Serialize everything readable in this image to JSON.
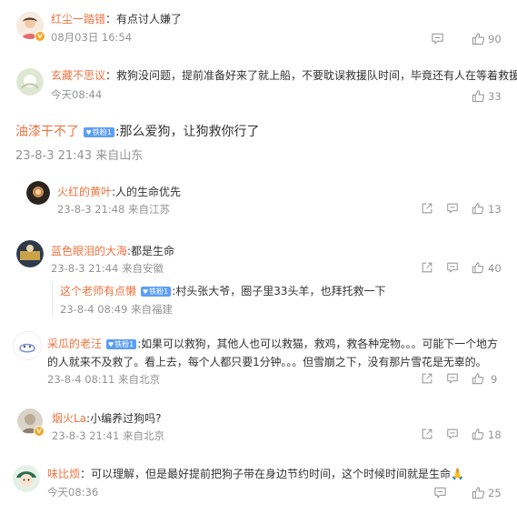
{
  "colors": {
    "name": "#eb7340",
    "meta": "#939393",
    "text": "#333333",
    "fan_badge": "#5b9ef5",
    "vip": "#f5a623"
  },
  "comments": [
    {
      "user": "红尘一踏错",
      "sep": "：",
      "text": "有点讨人嫌了",
      "time": "08月03日 16:54",
      "likes": "90"
    },
    {
      "user": "玄藏不思议",
      "sep": "：",
      "text": "救狗没问题，提前准备好来了就上船，不要耽误救援队时间，毕竟还有人在等着救援呢。",
      "time": "今天08:44",
      "likes": "33"
    },
    {
      "user": "油漆干不了",
      "badge": "铁粉1",
      "text": ":那么爱狗，让狗救你行了",
      "time": "23-8-3 21:43 来自山东"
    },
    {
      "user": "火红的黄叶",
      "text": ":人的生命优先",
      "time": "23-8-3 21:48 来自江苏",
      "likes": "13"
    },
    {
      "user": "蓝色眼泪的大海",
      "text": ":都是生命",
      "time": "23-8-3 21:44 来自安徽",
      "likes": "40"
    },
    {
      "user": "这个老师有点懒",
      "badge": "铁粉1",
      "text": ":村头张大爷，圈子里33头羊，也拜托救一下",
      "time": "23-8-4 08:49 来自福建"
    },
    {
      "user": "采瓜的老汪",
      "badge": "铁粉1",
      "text_line1": ":如果可以救狗，其他人也可以救猫，救鸡，救各种宠物。。。可能下一个地方",
      "text_line2": "的人就来不及救了。看上去，每个人都只要1分钟。。。但雪崩之下，没有那片雪花是无辜的。",
      "time": "23-8-4 08:11 来自北京",
      "likes": "9"
    },
    {
      "user": "烟火La",
      "text": ":小编养过狗吗?",
      "time": "23-8-3 21:41 来自北京",
      "likes": "18"
    },
    {
      "user": "味比烦",
      "sep": "：",
      "text": "可以理解，但是最好提前把狗子带在身边节约时间，这个时候时间就是生命",
      "emoji": "🙏",
      "time": "今天08:36",
      "likes": "25"
    }
  ],
  "icons": {
    "share": "share-icon",
    "comment": "comment-icon",
    "like": "thumbs-up-icon",
    "vip": "vip-badge-icon",
    "fan": "fan-badge-icon"
  }
}
